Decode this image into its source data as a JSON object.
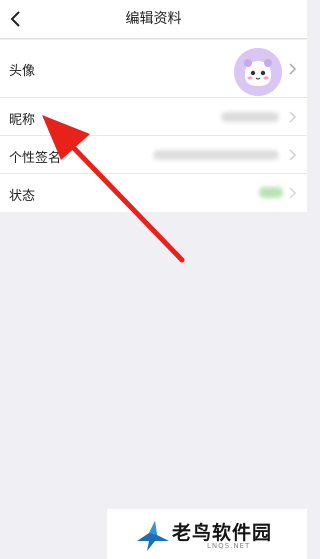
{
  "header": {
    "title": "编辑资料",
    "back_icon": "back-arrow-icon"
  },
  "profile_rows": [
    {
      "label": "头像",
      "value_type": "avatar"
    },
    {
      "label": "昵称",
      "value_type": "blurred-text"
    },
    {
      "label": "个性签名",
      "value_type": "blurred-text"
    },
    {
      "label": "状态",
      "value_type": "blurred-badge"
    }
  ],
  "annotation": {
    "arrow_color": "#e8211a"
  },
  "watermark": {
    "brand": "老鸟软件园",
    "domain": "LNQS.NET"
  },
  "colors": {
    "background": "#efeff4",
    "avatar_bg": "#d9c6f3",
    "status_badge": "#b9e3b4"
  }
}
